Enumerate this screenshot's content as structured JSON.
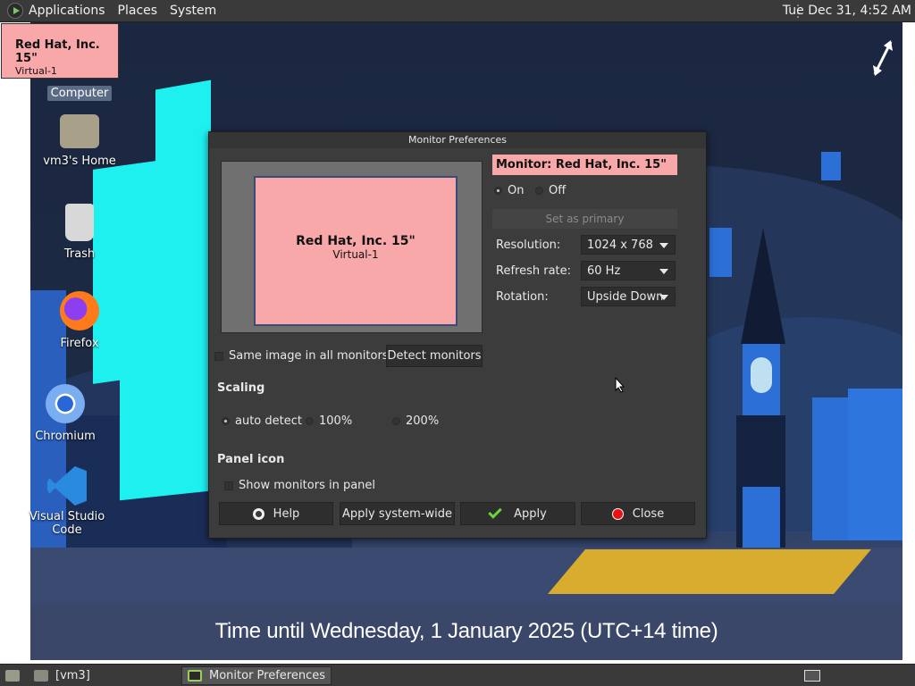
{
  "top_panel": {
    "menus": [
      "Applications",
      "Places",
      "System"
    ],
    "clock": "Tue Dec 31,  4:52 AM"
  },
  "monitor_tooltip": {
    "name": "Red Hat, Inc. 15\"",
    "sub": "Virtual-1"
  },
  "desktop_icons": [
    {
      "label": "Computer",
      "icon": "computer-icon"
    },
    {
      "label": "vm3's Home",
      "icon": "home-folder-icon"
    },
    {
      "label": "Trash",
      "icon": "trash-icon"
    },
    {
      "label": "Firefox",
      "icon": "firefox-icon"
    },
    {
      "label": "Chromium",
      "icon": "chromium-icon"
    },
    {
      "label": "Visual Studio Code",
      "icon": "vscode-icon"
    }
  ],
  "banner": "Time until Wednesday, 1 January 2025 (UTC+14 time)",
  "dialog": {
    "title": "Monitor Preferences",
    "preview": {
      "name": "Red Hat, Inc. 15\"",
      "sub": "Virtual-1"
    },
    "monitor_label": "Monitor: Red Hat, Inc. 15\"",
    "on_label": "On",
    "off_label": "Off",
    "set_primary_label": "Set as primary",
    "resolution_label": "Resolution:",
    "resolution_value": "1024 x 768",
    "refresh_label": "Refresh rate:",
    "refresh_value": "60 Hz",
    "rotation_label": "Rotation:",
    "rotation_value": "Upside Down",
    "same_image_label": "Same image in all monitors",
    "detect_label": "Detect monitors",
    "scaling_title": "Scaling",
    "scaling_options": [
      "auto detect",
      "100%",
      "200%"
    ],
    "panel_icon_title": "Panel icon",
    "show_monitors_label": "Show monitors in panel",
    "buttons": {
      "help": "Help",
      "apply_system": "Apply system-wide",
      "apply": "Apply",
      "close": "Close"
    }
  },
  "bottom_panel": {
    "tasks": [
      "[vm3]",
      "Monitor Preferences"
    ]
  },
  "colors": {
    "accent_pink": "#f8a8a8",
    "panel": "#3a3a3a",
    "dialog": "#3c3c3c"
  }
}
